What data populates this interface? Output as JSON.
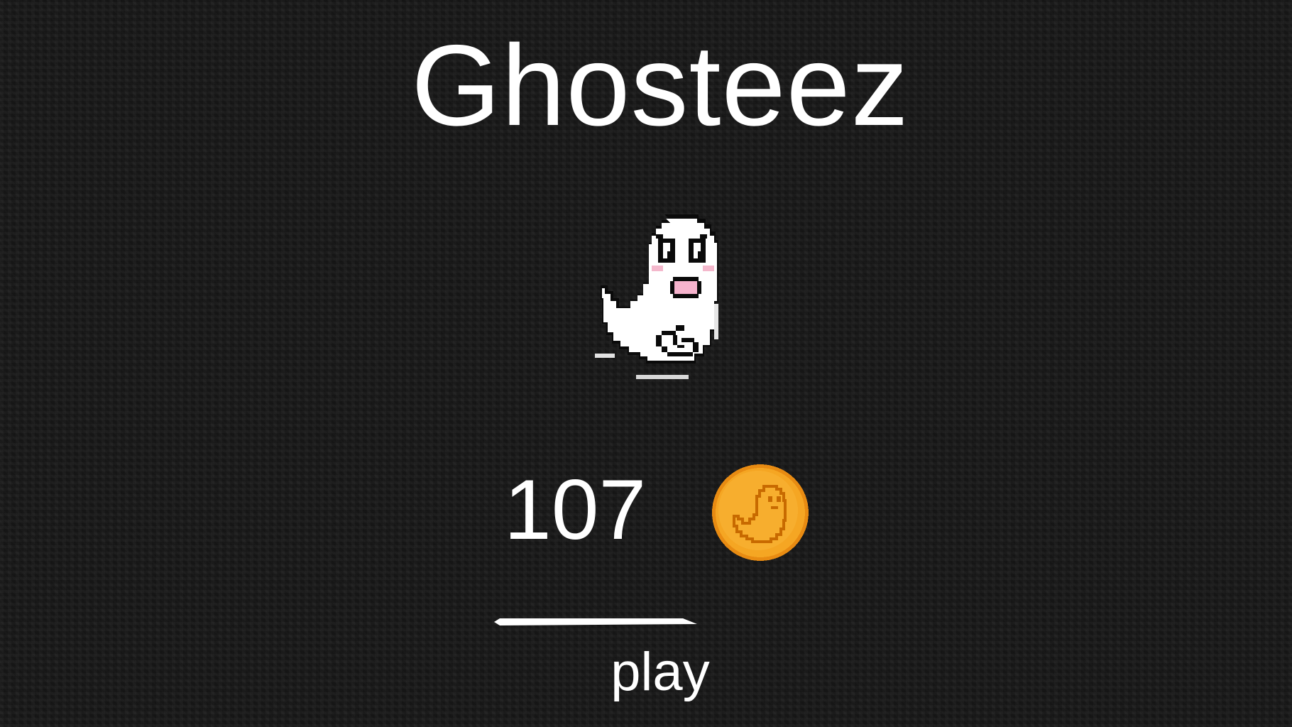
{
  "title": "Ghosteez",
  "character": {
    "icon": "ghost-icon"
  },
  "coins": {
    "count": "107",
    "icon": "coin-icon",
    "color": "#f5a623"
  },
  "play": {
    "label": "play"
  },
  "colors": {
    "background": "#171717",
    "text": "#ffffff"
  }
}
